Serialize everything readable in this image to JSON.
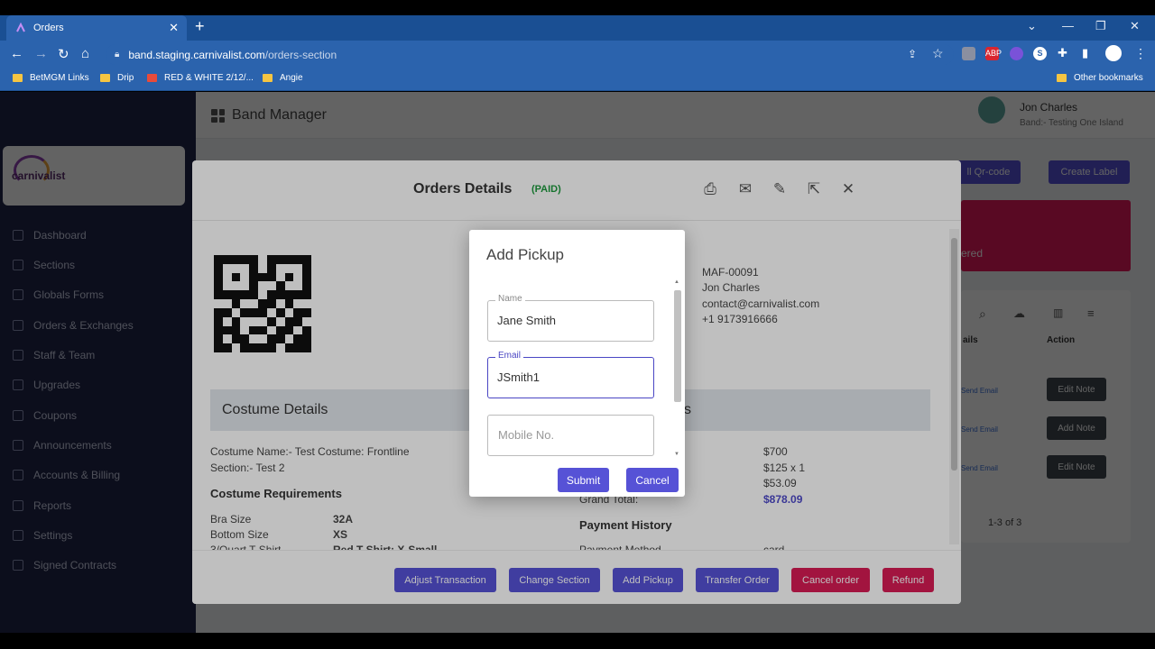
{
  "browser": {
    "tab_title": "Orders",
    "url_host": "band.staging.carnivalist.com",
    "url_path": "/orders-section",
    "bookmarks": [
      "BetMGM Links",
      "Drip",
      "RED & WHITE 2/12/...",
      "Angie"
    ],
    "other_bookmarks": "Other bookmarks",
    "extensions": [
      "ABP",
      "S"
    ]
  },
  "app": {
    "title": "Band Manager",
    "user_name": "Jon Charles",
    "user_band": "Band:- Testing One Island",
    "logo_text": "carnivalist",
    "nav": [
      "Dashboard",
      "Sections",
      "Globals Forms",
      "Orders & Exchanges",
      "Staff & Team",
      "Upgrades",
      "Coupons",
      "Announcements",
      "Accounts & Billing",
      "Reports",
      "Settings",
      "Signed Contracts"
    ],
    "bg_buttons": {
      "qr": "ll Qr-code",
      "label": "Create Label"
    },
    "banner_text": "ered",
    "table_headers": [
      "ails",
      "Action"
    ],
    "rows": [
      {
        "send": "Send Email",
        "action": "Edit Note"
      },
      {
        "send": "Send Email",
        "action": "Add Note"
      },
      {
        "send": "Send Email",
        "action": "Edit Note"
      }
    ],
    "pager": "1-3 of 3"
  },
  "orders_modal": {
    "title": "Orders Details",
    "status": "(PAID)",
    "contact": {
      "order_id": "MAF-00091",
      "name": "Jon Charles",
      "email": "contact@carnivalist.com",
      "phone": "+1 9173916666"
    },
    "costume_details_title": "Costume Details",
    "right_section_fragment": "s",
    "costume_name": "Costume Name:- Test Costume: Frontline",
    "section": "Section:- Test 2",
    "requirements_title": "Costume Requirements",
    "requirements": [
      {
        "label": "Bra Size",
        "value": "32A"
      },
      {
        "label": "Bottom Size",
        "value": "XS"
      },
      {
        "label": "3/Quart T-Shirt",
        "value": "Red T-Shirt: X-Small"
      }
    ],
    "prices": [
      "$700",
      "$125 x 1",
      "$53.09"
    ],
    "grand_total_label": "Grand Total:",
    "grand_total": "$878.09",
    "payment_history_title": "Payment History",
    "payment_method_label": "Payment Method",
    "payment_method_value": "card",
    "footer_buttons": [
      "Adjust Transaction",
      "Change Section",
      "Add Pickup",
      "Transfer Order",
      "Cancel order",
      "Refund"
    ]
  },
  "pickup_dialog": {
    "title": "Add Pickup",
    "name_label": "Name",
    "name_value": "Jane Smith",
    "email_label": "Email",
    "email_value": "JSmith1",
    "mobile_placeholder": "Mobile No.",
    "submit": "Submit",
    "cancel": "Cancel"
  }
}
